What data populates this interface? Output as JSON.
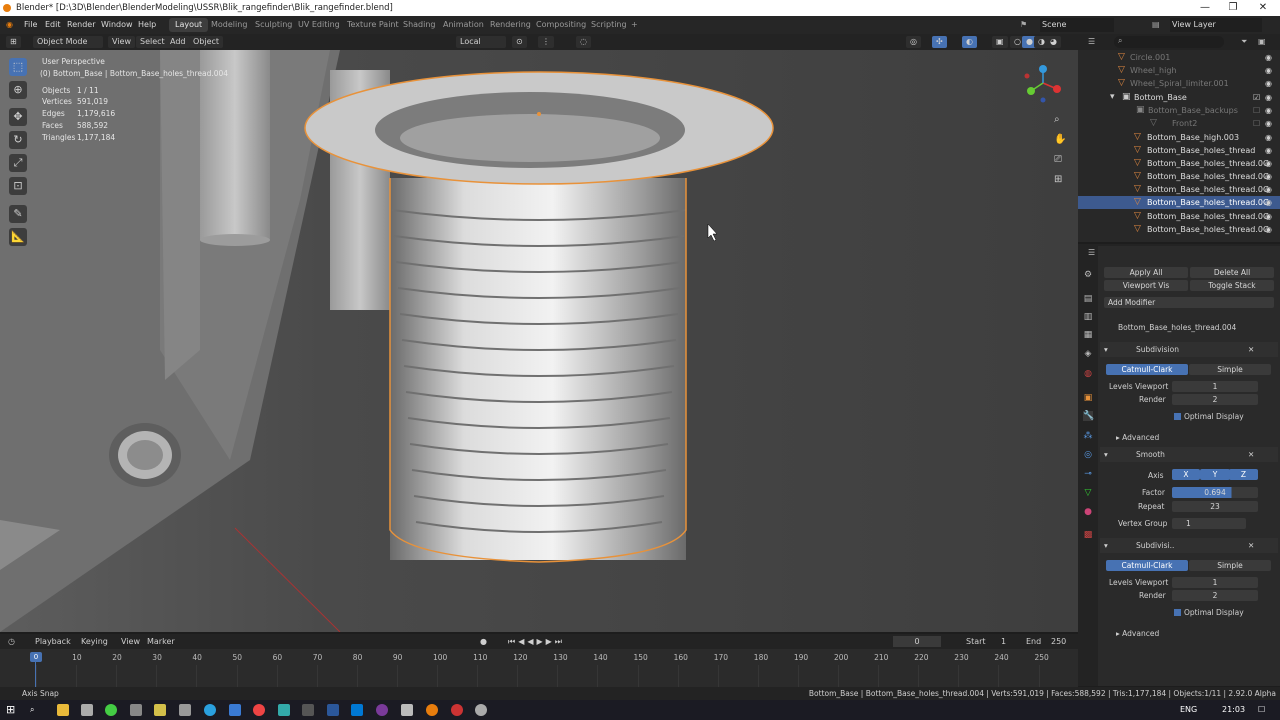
{
  "window": {
    "title": "Blender* [D:\\3D\\Blender\\BlenderModeling\\USSR\\Blik_rangefinder\\Blik_rangefinder.blend]",
    "min": "—",
    "restore": "❐",
    "close": "✕"
  },
  "menu": {
    "items": [
      "File",
      "Edit",
      "Render",
      "Window",
      "Help"
    ],
    "workspaces": [
      "Layout",
      "Modeling",
      "Sculpting",
      "UV Editing",
      "Texture Paint",
      "Shading",
      "Animation",
      "Rendering",
      "Compositing",
      "Scripting",
      "+"
    ],
    "scene": "Scene",
    "view_layer": "View Layer"
  },
  "viewport_header": {
    "mode": "Object Mode",
    "view": "View",
    "select": "Select",
    "add": "Add",
    "object": "Object",
    "orientation": "Local"
  },
  "overlay": {
    "perspective": "User Perspective",
    "active": "(0) Bottom_Base | Bottom_Base_holes_thread.004",
    "stats": [
      [
        "Objects",
        "1 / 11"
      ],
      [
        "Vertices",
        "591,019"
      ],
      [
        "Edges",
        "1,179,616"
      ],
      [
        "Faces",
        "588,592"
      ],
      [
        "Triangles",
        "1,177,184"
      ]
    ]
  },
  "outliner": {
    "rows": [
      {
        "name": "Circle.001",
        "dim": true,
        "indent": 2
      },
      {
        "name": "Wheel_high",
        "dim": true,
        "indent": 2
      },
      {
        "name": "Wheel_Spiral_limiter.001",
        "dim": true,
        "indent": 2
      },
      {
        "name": "Bottom_Base",
        "dim": false,
        "indent": 1,
        "collection": true
      },
      {
        "name": "Bottom_Base_backups",
        "dim": true,
        "indent": 2,
        "collection": true
      },
      {
        "name": "Front2",
        "dim": true,
        "indent": 3
      },
      {
        "name": "Bottom_Base_high.003",
        "dim": false,
        "indent": 2
      },
      {
        "name": "Bottom_Base_holes_thread",
        "dim": false,
        "indent": 2
      },
      {
        "name": "Bottom_Base_holes_thread.0C",
        "dim": false,
        "indent": 2
      },
      {
        "name": "Bottom_Base_holes_thread.0C",
        "dim": false,
        "indent": 2
      },
      {
        "name": "Bottom_Base_holes_thread.0C",
        "dim": false,
        "indent": 2
      },
      {
        "name": "Bottom_Base_holes_thread.0C",
        "dim": false,
        "indent": 2,
        "selected": true
      },
      {
        "name": "Bottom_Base_holes_thread.0C",
        "dim": false,
        "indent": 2
      },
      {
        "name": "Bottom_Base_holes_thread.0C",
        "dim": false,
        "indent": 2
      }
    ]
  },
  "properties": {
    "apply_all": "Apply All",
    "delete_all": "Delete All",
    "viewport_vis": "Viewport Vis",
    "toggle_stack": "Toggle Stack",
    "add_modifier": "Add Modifier",
    "object_name": "Bottom_Base_holes_thread.004",
    "mod1": {
      "name": "Subdivision",
      "catmull": "Catmull-Clark",
      "simple": "Simple",
      "levels_label": "Levels Viewport",
      "levels": "1",
      "render_label": "Render",
      "render": "2",
      "optimal": "Optimal Display",
      "advanced": "Advanced"
    },
    "mod2": {
      "name": "Smooth",
      "axis_label": "Axis",
      "x": "X",
      "y": "Y",
      "z": "Z",
      "factor_label": "Factor",
      "factor": "0.694",
      "repeat_label": "Repeat",
      "repeat": "23",
      "vgroup_label": "Vertex Group",
      "vgroup": "1"
    },
    "mod3": {
      "name": "Subdivisi..",
      "catmull": "Catmull-Clark",
      "simple": "Simple",
      "levels_label": "Levels Viewport",
      "levels": "1",
      "render_label": "Render",
      "render": "2",
      "optimal": "Optimal Display",
      "advanced": "Advanced"
    }
  },
  "timeline": {
    "playback": "Playback",
    "keying": "Keying",
    "view": "View",
    "marker": "Marker",
    "current": "0",
    "start_label": "Start",
    "start": "1",
    "end_label": "End",
    "end": "250",
    "frames": [
      "0",
      "10",
      "20",
      "30",
      "40",
      "50",
      "60",
      "70",
      "80",
      "90",
      "100",
      "110",
      "120",
      "130",
      "140",
      "150",
      "160",
      "170",
      "180",
      "190",
      "200",
      "210",
      "220",
      "230",
      "240",
      "250"
    ]
  },
  "status": {
    "left": "Axis Snap",
    "right": "Bottom_Base | Bottom_Base_holes_thread.004 | Verts:591,019 | Faces:588,592 | Tris:1,177,184 | Objects:1/11 | 2.92.0 Alpha"
  },
  "taskbar": {
    "lang": "ENG",
    "time": "21:03"
  }
}
